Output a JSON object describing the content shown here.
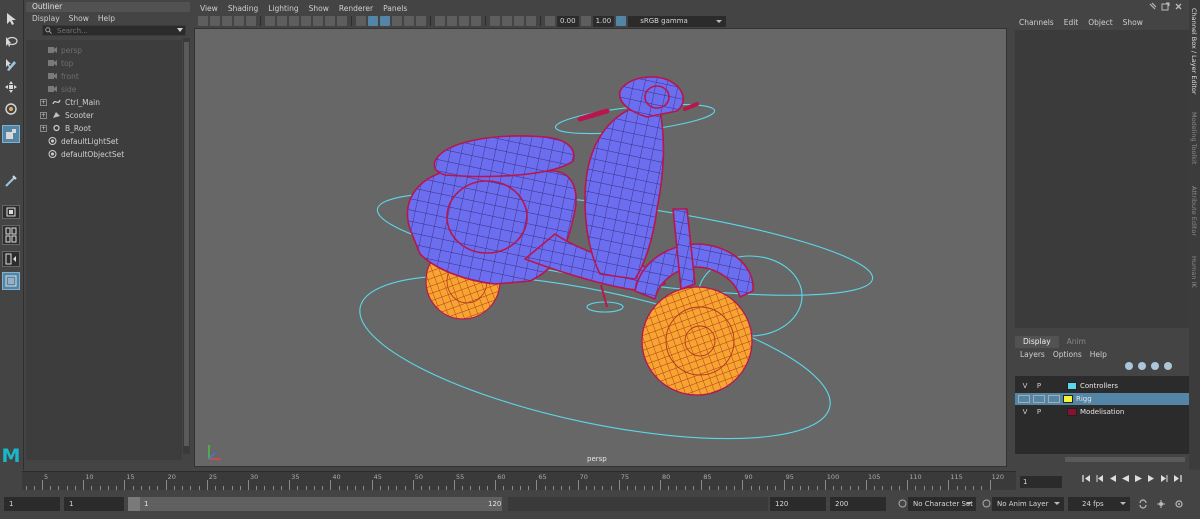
{
  "outliner": {
    "title": "Outliner",
    "menu": [
      "Display",
      "Show",
      "Help"
    ],
    "search_placeholder": "Search...",
    "items": [
      {
        "label": "persp",
        "type": "camera",
        "hidden": true
      },
      {
        "label": "top",
        "type": "camera",
        "hidden": true
      },
      {
        "label": "front",
        "type": "camera",
        "hidden": true
      },
      {
        "label": "side",
        "type": "camera",
        "hidden": true
      },
      {
        "label": "Ctrl_Main",
        "type": "curve",
        "expandable": true
      },
      {
        "label": "Scooter",
        "type": "mesh",
        "expandable": true
      },
      {
        "label": "B_Root",
        "type": "joint",
        "expandable": true
      },
      {
        "label": "defaultLightSet",
        "type": "set"
      },
      {
        "label": "defaultObjectSet",
        "type": "set"
      }
    ]
  },
  "viewport": {
    "menu": [
      "View",
      "Shading",
      "Lighting",
      "Show",
      "Renderer",
      "Panels"
    ],
    "exposure": "0.00",
    "gamma": "1.00",
    "color_space": "sRGB gamma",
    "camera_label": "persp"
  },
  "channel_box": {
    "menu": [
      "Channels",
      "Edit",
      "Object",
      "Show"
    ]
  },
  "layer_editor": {
    "tabs": [
      "Display",
      "Anim"
    ],
    "menu": [
      "Layers",
      "Options",
      "Help"
    ],
    "layers": [
      {
        "v": "V",
        "p": "P",
        "name": "Controllers",
        "color": "#5ad8ea",
        "selected": false
      },
      {
        "v": "",
        "p": "",
        "name": "Rigg",
        "color": "#f4f43a",
        "selected": true
      },
      {
        "v": "V",
        "p": "P",
        "name": "Modelisation",
        "color": "#8a1030",
        "selected": false
      }
    ]
  },
  "side_tabs": [
    "Channel Box / Layer Editor",
    "Modeling Toolkit",
    "Attribute Editor",
    "Human IK"
  ],
  "timeline": {
    "ticks": [
      "5",
      "10",
      "15",
      "20",
      "25",
      "30",
      "35",
      "40",
      "45",
      "50",
      "55",
      "60",
      "65",
      "70",
      "75",
      "80",
      "85",
      "90",
      "95",
      "100",
      "105",
      "110",
      "115",
      "120"
    ],
    "current_frame": "1"
  },
  "range": {
    "start": "1",
    "playback_start": "1",
    "bar_start": "1",
    "bar_end": "120",
    "playback_end": "120",
    "end": "200",
    "character_set": "No Character Set",
    "anim_layer": "No Anim Layer",
    "fps": "24 fps"
  },
  "colors": {
    "mesh_body": "#6c6ef0",
    "mesh_wire": "#b8164d",
    "wheel": "#f7a531",
    "controller": "#5ad8ea",
    "accent": "#5285a6"
  }
}
